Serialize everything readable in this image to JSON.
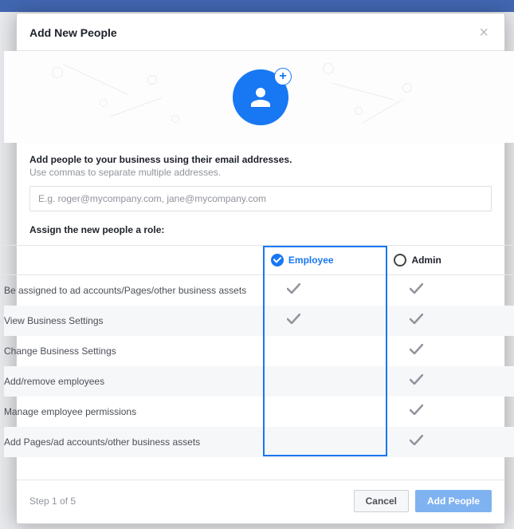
{
  "modal": {
    "title": "Add New People",
    "email_heading": "Add people to your business using their email addresses.",
    "email_sub": "Use commas to separate multiple addresses.",
    "email_placeholder": "E.g. roger@mycompany.com, jane@mycompany.com",
    "role_heading": "Assign the new people a role:",
    "roles": {
      "employee": "Employee",
      "admin": "Admin"
    },
    "permissions": [
      {
        "label": "Be assigned to ad accounts/Pages/other business assets",
        "employee": true,
        "admin": true
      },
      {
        "label": "View Business Settings",
        "employee": true,
        "admin": true
      },
      {
        "label": "Change Business Settings",
        "employee": false,
        "admin": true
      },
      {
        "label": "Add/remove employees",
        "employee": false,
        "admin": true
      },
      {
        "label": "Manage employee permissions",
        "employee": false,
        "admin": true
      },
      {
        "label": "Add Pages/ad accounts/other business assets",
        "employee": false,
        "admin": true
      }
    ],
    "step_text": "Step 1 of 5",
    "cancel_label": "Cancel",
    "submit_label": "Add People"
  }
}
